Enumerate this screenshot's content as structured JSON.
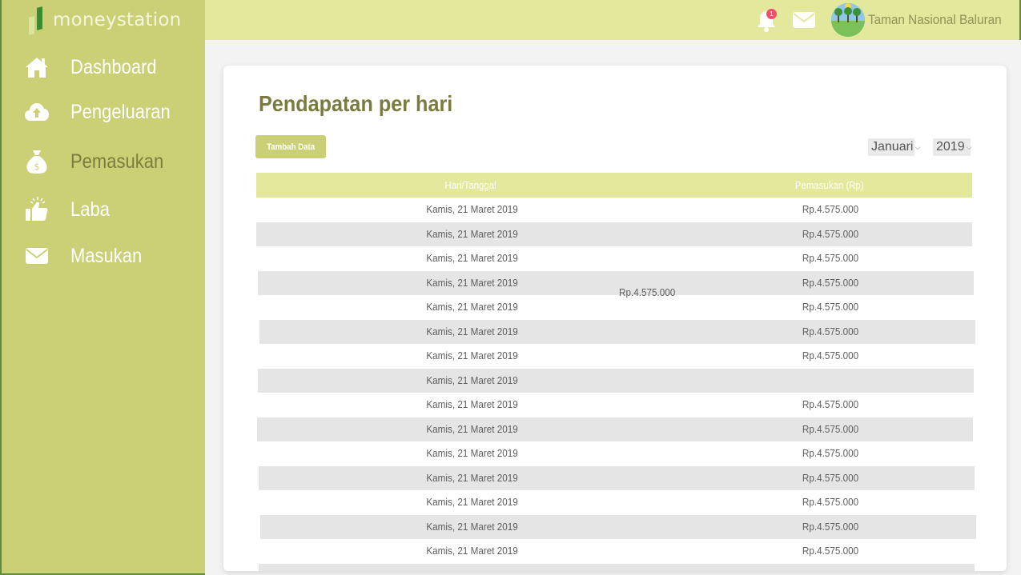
{
  "app": {
    "brand": "moneystation"
  },
  "sidebar": {
    "items": [
      {
        "label": "Dashboard",
        "icon": "home-icon"
      },
      {
        "label": "Pengeluaran",
        "icon": "cloud-upload-icon"
      },
      {
        "label": "Pemasukan",
        "icon": "money-bag-icon",
        "active": true
      },
      {
        "label": "Laba",
        "icon": "thumbs-up-icon"
      },
      {
        "label": "Masukan",
        "icon": "envelope-icon"
      }
    ]
  },
  "topbar": {
    "notification_count": "1",
    "user_name": "Taman Nasional Baluran"
  },
  "main": {
    "title": "Pendapatan per hari",
    "add_button": "Tambah Data",
    "month_select": "Januari",
    "year_select": "2019",
    "columns": [
      "Hari/Tanggal",
      "Pemasukan (Rp)"
    ],
    "rows": [
      {
        "date": "Kamis, 21 Maret 2019",
        "amount": "Rp.4.575.000"
      },
      {
        "date": "Kamis, 21 Maret 2019",
        "amount": "Rp.4.575.000"
      },
      {
        "date": "Kamis, 21 Maret 2019",
        "amount": "Rp.4.575.000"
      },
      {
        "date": "Kamis, 21 Maret 2019",
        "amount": "Rp.4.575.000"
      },
      {
        "date": "Kamis, 21 Maret 2019",
        "amount": "Rp.4.575.000"
      },
      {
        "date": "Kamis, 21 Maret 2019",
        "amount": "Rp.4.575.000"
      },
      {
        "date": "Kamis, 21 Maret 2019",
        "amount": "Rp.4.575.000"
      },
      {
        "date": "Kamis, 21 Maret 2019",
        "amount": ""
      },
      {
        "date": "Kamis, 21 Maret 2019",
        "amount": "Rp.4.575.000"
      },
      {
        "date": "Kamis, 21 Maret 2019",
        "amount": "Rp.4.575.000"
      },
      {
        "date": "Kamis, 21 Maret 2019",
        "amount": "Rp.4.575.000"
      },
      {
        "date": "Kamis, 21 Maret 2019",
        "amount": "Rp.4.575.000"
      },
      {
        "date": "Kamis, 21 Maret 2019",
        "amount": "Rp.4.575.000"
      },
      {
        "date": "Kamis, 21 Maret 2019",
        "amount": "Rp.4.575.000"
      },
      {
        "date": "Kamis, 21 Maret 2019",
        "amount": "Rp.4.575.000"
      },
      {
        "date": "",
        "amount": ""
      }
    ],
    "stray_amount": "Rp.4.575.000"
  },
  "colors": {
    "sidebar_bg": "#cbcf75",
    "topbar_bg": "#e4e89d",
    "table_header_bg": "#e4e89d",
    "row_alt_bg": "#e5e5e5",
    "title_text": "#7a7b3f",
    "badge": "#f04f6a"
  }
}
